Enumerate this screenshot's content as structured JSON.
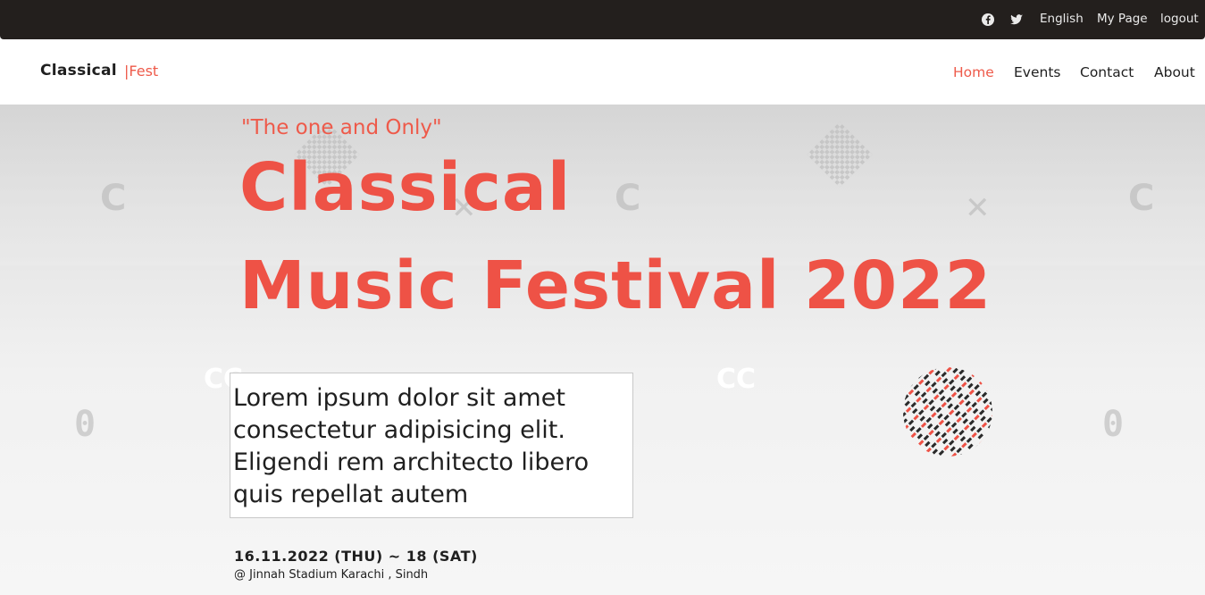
{
  "topbar": {
    "icons": [
      "facebook-icon",
      "twitter-icon"
    ],
    "links": [
      "English",
      "My Page",
      "logout"
    ]
  },
  "navbar": {
    "brand": "Classical",
    "brand_sub": "|Fest",
    "items": [
      "Home",
      "Events",
      "Contact",
      "About"
    ],
    "active_item": "Home"
  },
  "hero": {
    "tagline": "\"The one and Only\"",
    "title_line1": "Classical",
    "title_line2": "Music Festival 2022",
    "description": "Lorem ipsum dolor sit amet consectetur adipisicing elit. Eligendi rem architecto libero quis repellat autem",
    "date": "16.11.2022 (THU) ~ 18 (SAT)",
    "venue": "@ Jinnah Stadium Karachi , Sindh"
  },
  "colors": {
    "accent": "#ee5246",
    "topbar_bg": "#231f1d",
    "text_dark": "#1f1f1f"
  }
}
